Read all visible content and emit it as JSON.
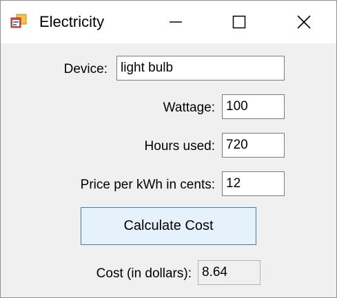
{
  "window": {
    "title": "Electricity",
    "icon": "app-form-icon",
    "controls": [
      "minimize-icon",
      "maximize-icon",
      "close-icon"
    ]
  },
  "form": {
    "device": {
      "label": "Device:",
      "value": "light bulb"
    },
    "wattage": {
      "label": "Wattage:",
      "value": "100"
    },
    "hours": {
      "label": "Hours used:",
      "value": "720"
    },
    "price": {
      "label": "Price per kWh in cents:",
      "value": "12"
    },
    "calculate_label": "Calculate Cost",
    "cost": {
      "label": "Cost (in dollars):",
      "value": "8.64"
    }
  },
  "colors": {
    "button_face": "#e5f1fb",
    "button_border": "#3c7fb1",
    "window_bg": "#f0f0f0"
  }
}
